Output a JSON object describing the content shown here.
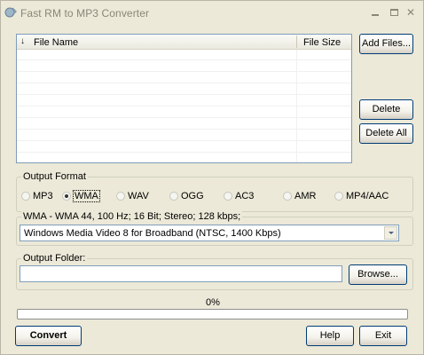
{
  "window": {
    "title": "Fast RM to MP3 Converter",
    "controls": {
      "minimize": "minimize",
      "maximize": "maximize",
      "close": "✕"
    }
  },
  "file_list": {
    "sort_indicator": "↓",
    "columns": [
      "File Name",
      "File Size"
    ],
    "rows": []
  },
  "buttons": {
    "add_files": "Add Files...",
    "delete": "Delete",
    "delete_all": "Delete All",
    "browse": "Browse...",
    "convert": "Convert",
    "help": "Help",
    "exit": "Exit"
  },
  "output_format": {
    "label": "Output Format",
    "selected": "WMA",
    "options": [
      "MP3",
      "WMA",
      "WAV",
      "OGG",
      "AC3",
      "AMR",
      "MP4/AAC"
    ]
  },
  "settings": {
    "label": "WMA - WMA 44, 100 Hz; 16 Bit; Stereo; 128 kbps;",
    "profile_value": "Windows Media Video 8 for Broadband (NTSC, 1400 Kbps)"
  },
  "output_folder": {
    "label": "Output Folder:",
    "value": ""
  },
  "progress": {
    "text": "0%",
    "fraction": 0
  }
}
